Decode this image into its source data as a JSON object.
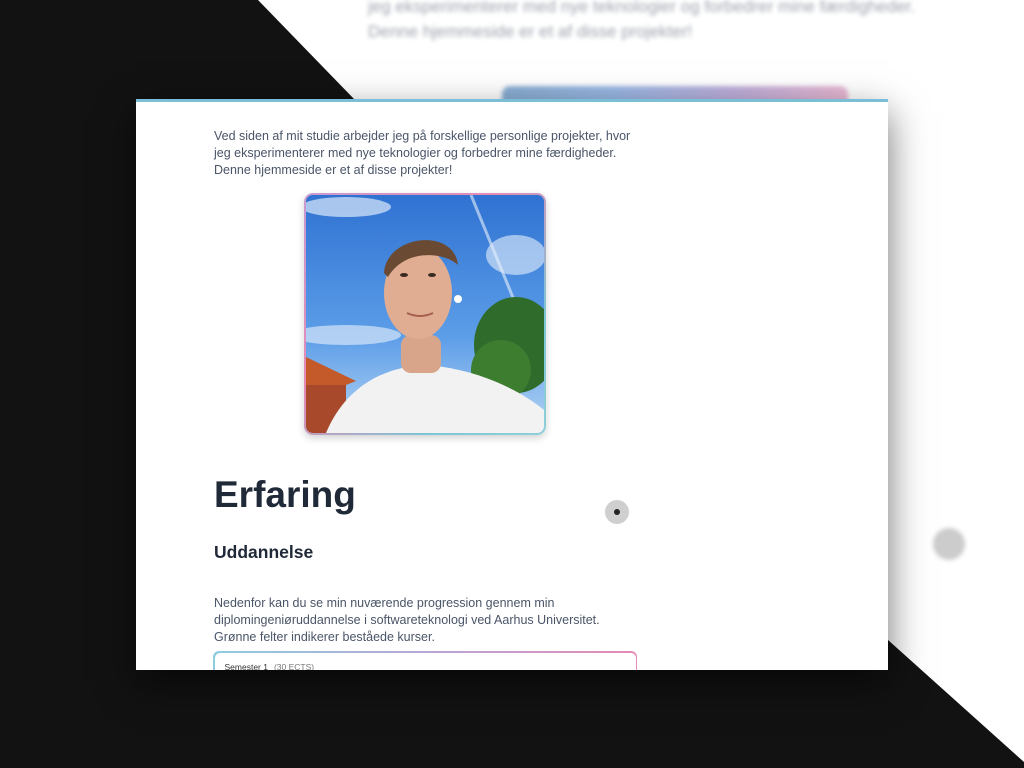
{
  "background": {
    "text_line_1": "jeg eksperimenterer med nye teknologier og forbedrer mine færdigheder.",
    "text_line_2": "Denne hjemmeside er et af disse projekter!"
  },
  "intro": {
    "text": "Ved siden af mit studie arbejder jeg på forskellige personlige projekter, hvor jeg eksperimenterer med nye teknologier og forbedrer mine færdigheder. Denne hjemmeside er et af disse projekter!"
  },
  "profile_photo": {
    "alt": "Profilbillede"
  },
  "section": {
    "title": "Erfaring",
    "subtitle": "Uddannelse",
    "description": "Nedenfor kan du se min nuværende progression gennem min diplomingeniøruddannelse i softwareteknologi ved Aarhus Universitet. Grønne felter indikerer beståede kurser."
  },
  "semester": {
    "label": "Semester 1",
    "ects": "(30 ECTS)"
  },
  "colors": {
    "accent_top": "#7bbfd6",
    "gradient_pink": "#e58bb5",
    "gradient_teal": "#7bc6d6",
    "heading": "#1f2937",
    "body_text": "#4a5568"
  }
}
